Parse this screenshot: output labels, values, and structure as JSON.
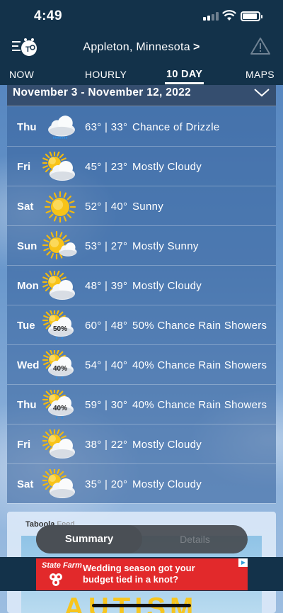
{
  "status_bar": {
    "time": "4:49"
  },
  "header": {
    "location": "Appleton, Minnesota",
    "location_chevron": ">",
    "menu_icon": "menu-logo-icon",
    "alert_icon": "warning-triangle-icon"
  },
  "tabs": [
    {
      "label": "NOW",
      "active": false
    },
    {
      "label": "HOURLY",
      "active": false
    },
    {
      "label": "10 DAY",
      "active": true
    },
    {
      "label": "MAPS",
      "active": false
    }
  ],
  "forecast": {
    "range": "November 3  - November 12, 2022",
    "days": [
      {
        "day": "Thu",
        "temps": "63° | 33°",
        "condition": "Chance  of  Drizzle",
        "icon": "drizzle-icon"
      },
      {
        "day": "Fri",
        "temps": "45° | 23°",
        "condition": "Mostly Cloudy",
        "icon": "mostly-cloudy-icon"
      },
      {
        "day": "Sat",
        "temps": "52° | 40°",
        "condition": "Sunny",
        "icon": "sunny-icon"
      },
      {
        "day": "Sun",
        "temps": "53° | 27°",
        "condition": "Mostly Sunny",
        "icon": "mostly-sunny-icon"
      },
      {
        "day": "Mon",
        "temps": "48° | 39°",
        "condition": "Mostly Cloudy",
        "icon": "mostly-cloudy-icon"
      },
      {
        "day": "Tue",
        "temps": "60° | 48°",
        "condition": "50% Chance Rain Showers",
        "icon": "rain-showers-icon",
        "pct": "50%"
      },
      {
        "day": "Wed",
        "temps": "54° | 40°",
        "condition": "40% Chance Rain Showers",
        "icon": "rain-showers-icon",
        "pct": "40%"
      },
      {
        "day": "Thu",
        "temps": "59° | 30°",
        "condition": "40% Chance Rain Showers",
        "icon": "rain-showers-icon",
        "pct": "40%"
      },
      {
        "day": "Fri",
        "temps": "38° | 22°",
        "condition": "Mostly Cloudy",
        "icon": "mostly-cloudy-icon"
      },
      {
        "day": "Sat",
        "temps": "35° | 20°",
        "condition": "Mostly Cloudy",
        "icon": "mostly-cloudy-icon"
      }
    ]
  },
  "taboola": {
    "brand": "Taboola",
    "suffix": "Feed",
    "image_text": "AUTISM"
  },
  "segmented": {
    "summary": "Summary",
    "details": "Details",
    "selected": "Summary"
  },
  "ad": {
    "brand": "State Farm",
    "text": "Wedding season got your budget tied in a knot?",
    "color": "#e2292b"
  },
  "colors": {
    "header_bg": "#13324a",
    "panel_bg": "#34609a"
  }
}
